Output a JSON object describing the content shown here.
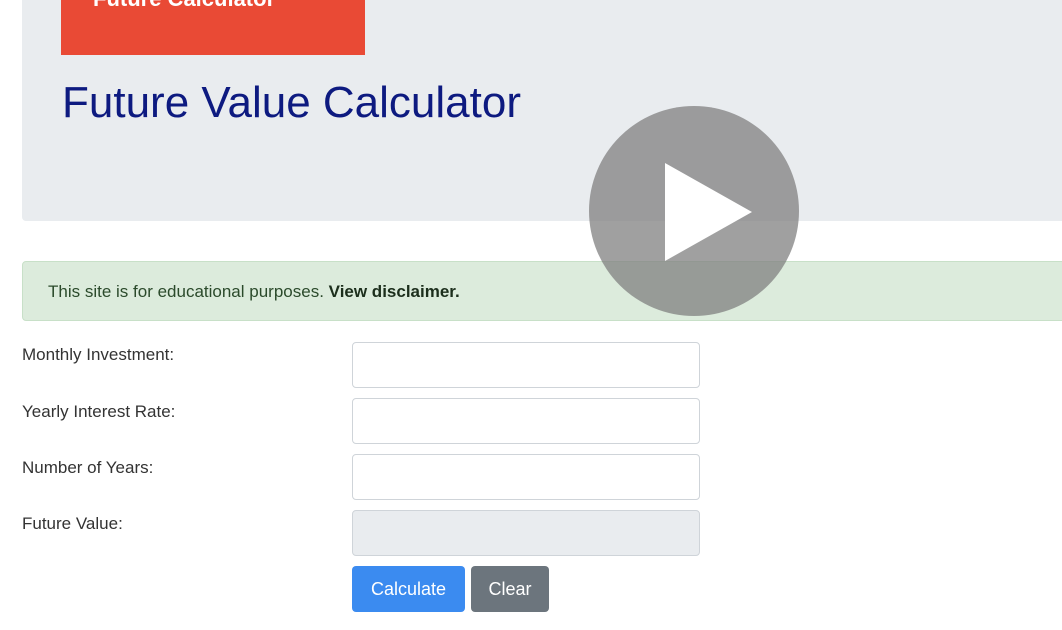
{
  "header": {
    "banner_label": "Future Calculator",
    "title": "Future Value Calculator"
  },
  "alert": {
    "text": "This site is for educational purposes. ",
    "link_label": "View disclaimer."
  },
  "form": {
    "fields": [
      {
        "label": "Monthly Investment:",
        "value": "",
        "readonly": false
      },
      {
        "label": "Yearly Interest Rate:",
        "value": "",
        "readonly": false
      },
      {
        "label": "Number of Years:",
        "value": "",
        "readonly": false
      },
      {
        "label": "Future Value:",
        "value": "",
        "readonly": true
      }
    ],
    "calculate_label": "Calculate",
    "clear_label": "Clear"
  },
  "video": {
    "play_icon": "play-icon"
  },
  "colors": {
    "banner": "#e94a35",
    "title": "#0d1a80",
    "alert_bg": "#dcebdc",
    "primary_button": "#3b8bf0",
    "secondary_button": "#6c757d"
  }
}
